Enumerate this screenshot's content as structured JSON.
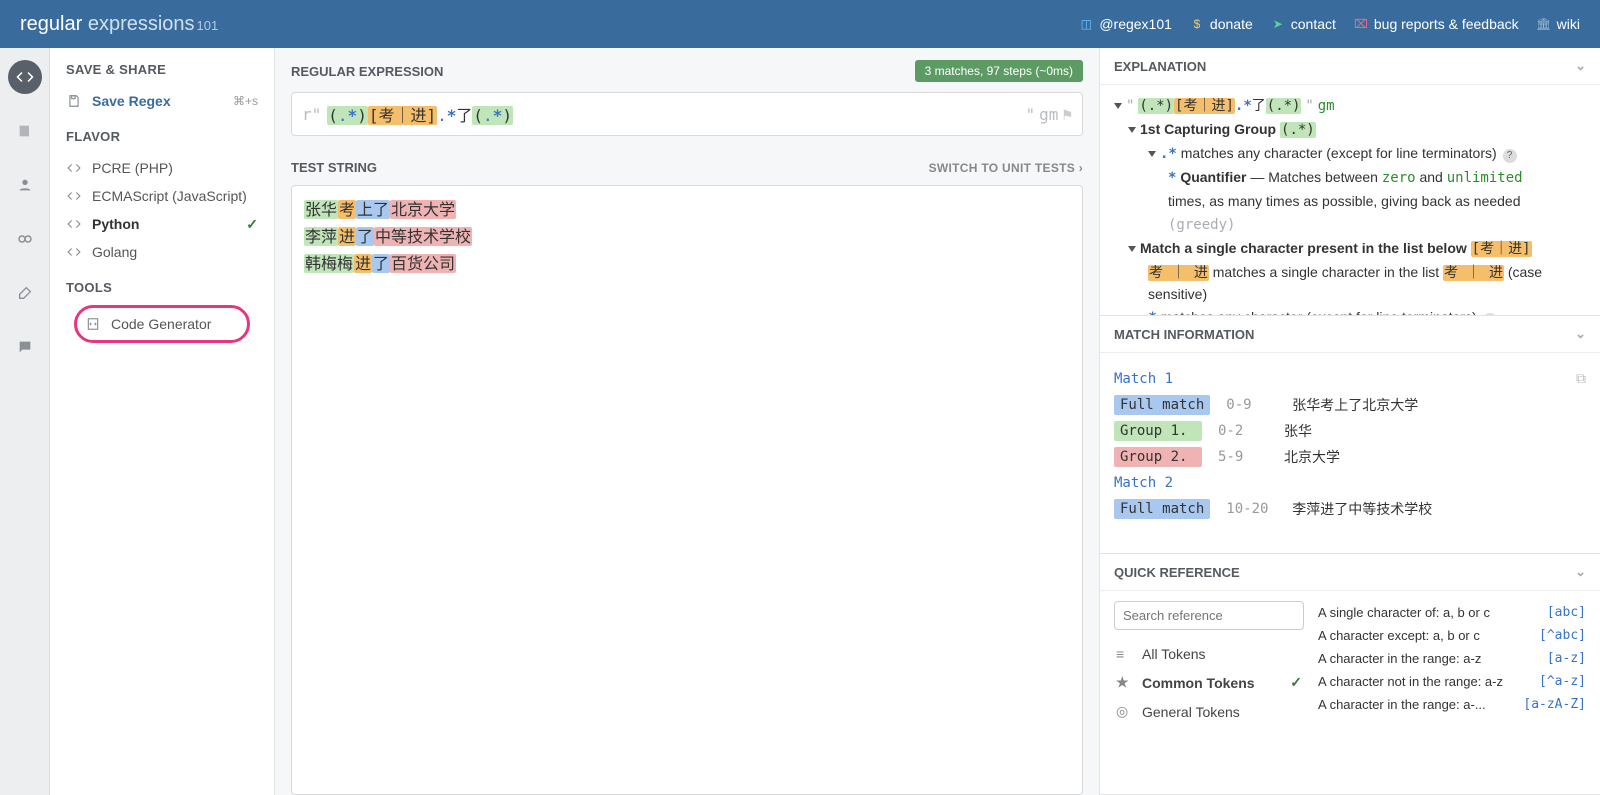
{
  "header": {
    "logo_main": "regular",
    "logo_sec": "expressions",
    "logo_sub": "101",
    "links": [
      {
        "icon": "twitter",
        "label": "@regex101"
      },
      {
        "icon": "dollar",
        "label": "donate"
      },
      {
        "icon": "send",
        "label": "contact"
      },
      {
        "icon": "bug",
        "label": "bug reports & feedback"
      },
      {
        "icon": "library",
        "label": "wiki"
      }
    ]
  },
  "sidebar": {
    "save_share": "SAVE & SHARE",
    "save_regex": "Save Regex",
    "save_shortcut": "⌘+s",
    "flavor_title": "FLAVOR",
    "flavors": [
      {
        "label": "PCRE (PHP)",
        "selected": false
      },
      {
        "label": "ECMAScript (JavaScript)",
        "selected": false
      },
      {
        "label": "Python",
        "selected": true
      },
      {
        "label": "Golang",
        "selected": false
      }
    ],
    "tools_title": "TOOLS",
    "tools": [
      {
        "label": "Code Generator"
      }
    ]
  },
  "editor": {
    "regex_title": "REGULAR EXPRESSION",
    "status": "3 matches, 97 steps (~0ms)",
    "prefix": "r\"",
    "flags": "gm",
    "test_title": "TEST STRING",
    "switch_link": "SWITCH TO UNIT TESTS",
    "test_lines": [
      {
        "g1": "张华",
        "m": "考",
        "mid": "上了",
        "g2": "北京大学"
      },
      {
        "g1": "李萍",
        "m": "进",
        "mid": "了",
        "g2": "中等技术学校"
      },
      {
        "g1": "韩梅梅",
        "m": "进",
        "mid": "了",
        "g2": "百货公司"
      }
    ]
  },
  "explanation": {
    "title": "EXPLANATION",
    "line1_q": "\"",
    "line1_flags": "gm",
    "group1": "1st Capturing Group",
    "group1_pat": "(.*)",
    "dotstar": ".*",
    "dot_desc": " matches any character (except for line terminators)",
    "quant": "Quantifier",
    "quant_desc1": " — Matches between ",
    "zero": "zero",
    "and": " and ",
    "unlimited": "unlimited",
    "quant_desc2": " times, as many times as possible, giving back as needed",
    "greedy": "(greedy)",
    "charclass": "Match a single character present in the list below",
    "cc_pat": "[考｜进]",
    "cc_inner": "考 ｜ 进",
    "cc_desc": " matches a single character in the list ",
    "cc_end": " (case sensitive)",
    "star": "*",
    "quant_desc3": " times, as many times as possible, giving back as needed "
  },
  "match_info": {
    "title": "MATCH INFORMATION",
    "matches": [
      {
        "title": "Match 1",
        "rows": [
          {
            "label": "Full match",
            "cls": "ml-full",
            "range": "0-9",
            "val": "张华考上了北京大学"
          },
          {
            "label": "Group 1.",
            "cls": "ml-g1",
            "range": "0-2",
            "val": "张华"
          },
          {
            "label": "Group 2.",
            "cls": "ml-g2",
            "range": "5-9",
            "val": "北京大学"
          }
        ]
      },
      {
        "title": "Match 2",
        "rows": [
          {
            "label": "Full match",
            "cls": "ml-full",
            "range": "10-20",
            "val": "李萍进了中等技术学校"
          }
        ]
      }
    ]
  },
  "quickref": {
    "title": "QUICK REFERENCE",
    "search_ph": "Search reference",
    "cats": [
      {
        "label": "All Tokens",
        "selected": false,
        "icon": "list"
      },
      {
        "label": "Common Tokens",
        "selected": true,
        "icon": "star"
      },
      {
        "label": "General Tokens",
        "selected": false,
        "icon": "target"
      }
    ],
    "items": [
      {
        "desc": "A single character of: a, b or c",
        "tok": "[abc]"
      },
      {
        "desc": "A character except: a, b or c",
        "tok": "[^abc]"
      },
      {
        "desc": "A character in the range: a-z",
        "tok": "[a-z]"
      },
      {
        "desc": "A character not in the range: a-z",
        "tok": "[^a-z]"
      },
      {
        "desc": "A character in the range: a-...",
        "tok": "[a-zA-Z]"
      }
    ]
  }
}
